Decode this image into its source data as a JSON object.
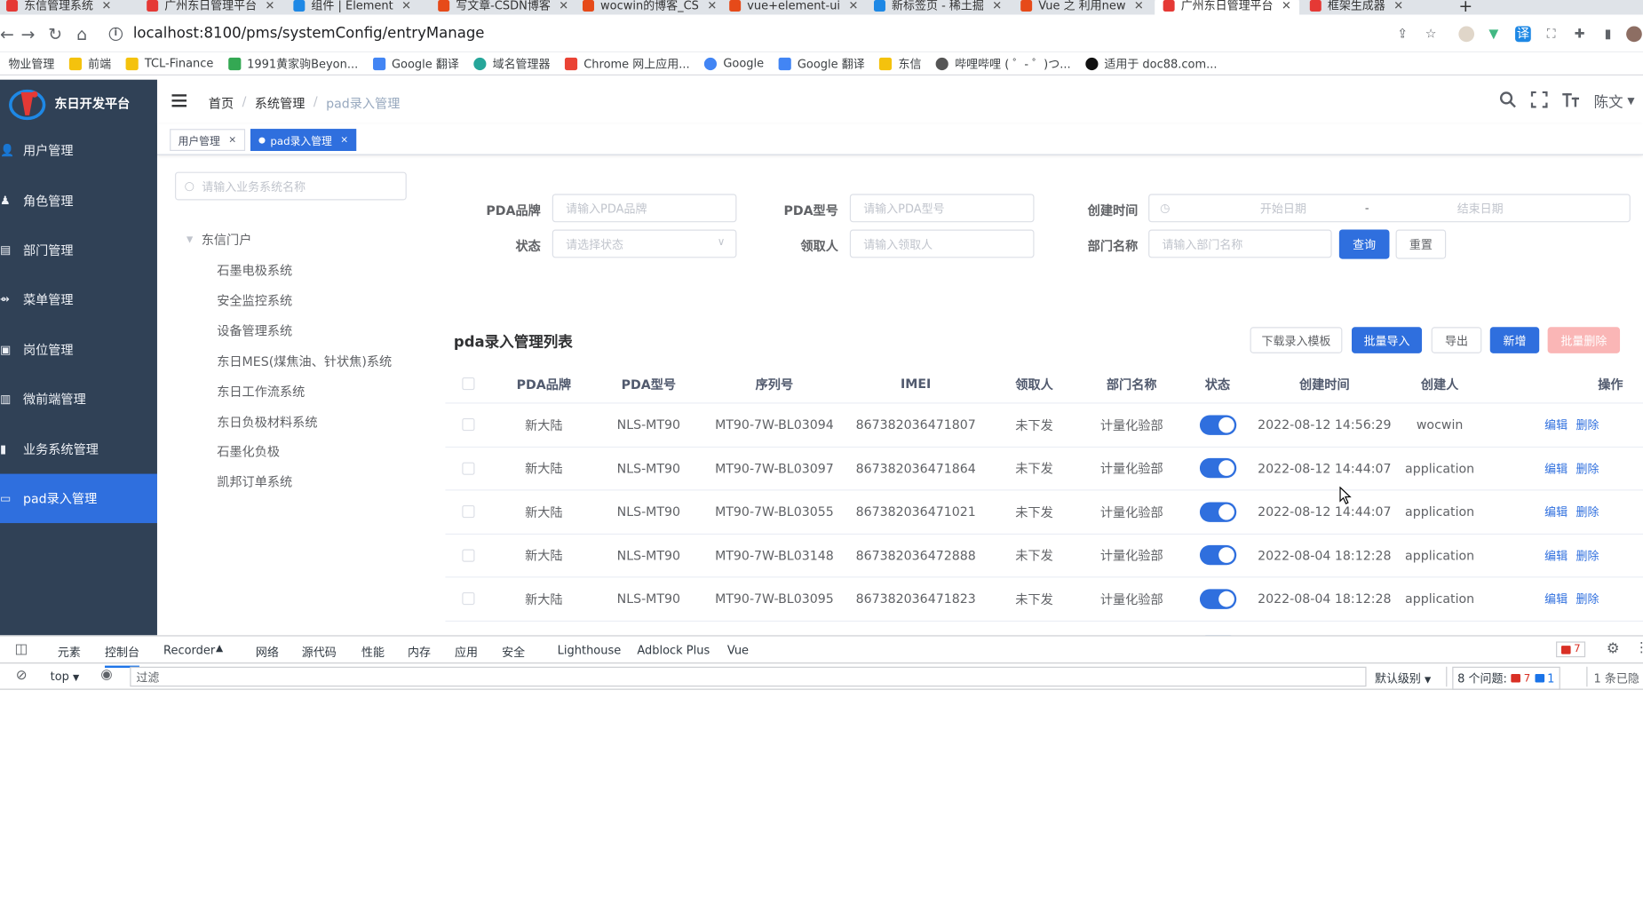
{
  "browser": {
    "tabs": [
      {
        "title": "东信管理系统",
        "color": "#e53935"
      },
      {
        "title": "广州东日管理平台",
        "color": "#e53935"
      },
      {
        "title": "组件 | Element",
        "color": "#1e88e5"
      },
      {
        "title": "写文章-CSDN博客",
        "color": "#e64a19"
      },
      {
        "title": "wocwin的博客_CS",
        "color": "#e64a19"
      },
      {
        "title": "vue+element-ui",
        "color": "#e64a19"
      },
      {
        "title": "新标签页 - 稀土掘",
        "color": "#1e88e5"
      },
      {
        "title": "Vue 之 利用new",
        "color": "#e64a19"
      },
      {
        "title": "广州东日管理平台",
        "color": "#e53935"
      },
      {
        "title": "框架生成器",
        "color": "#e53935"
      }
    ],
    "url": "localhost:8100/pms/systemConfig/entryManage",
    "bookmarks": [
      {
        "label": "物业管理",
        "color": "#f4c20d"
      },
      {
        "label": "前端",
        "color": "#f4c20d"
      },
      {
        "label": "TCL-Finance",
        "color": "#f4c20d"
      },
      {
        "label": "1991黄家驹Beyon...",
        "color": "#34a853"
      },
      {
        "label": "Google 翻译",
        "color": "#4285f4"
      },
      {
        "label": "域名管理器",
        "color": "#26a69a"
      },
      {
        "label": "Chrome 网上应用...",
        "color": "#ea4335"
      },
      {
        "label": "Google",
        "color": "#4285f4"
      },
      {
        "label": "Google 翻译",
        "color": "#4285f4"
      },
      {
        "label": "东信",
        "color": "#f4c20d"
      },
      {
        "label": "哔哩哔哩 ( ゜- ゜)つ...",
        "color": "#555555"
      },
      {
        "label": "适用于 doc88.com...",
        "color": "#111111"
      }
    ]
  },
  "app": {
    "logo_text": "东日开发平台",
    "menu": [
      {
        "label": "用户管理",
        "icon": "user-icon"
      },
      {
        "label": "角色管理",
        "icon": "role-icon"
      },
      {
        "label": "部门管理",
        "icon": "dept-icon"
      },
      {
        "label": "菜单管理",
        "icon": "menu-icon"
      },
      {
        "label": "岗位管理",
        "icon": "post-icon"
      },
      {
        "label": "微前端管理",
        "icon": "micro-icon"
      },
      {
        "label": "业务系统管理",
        "icon": "chart-icon"
      },
      {
        "label": "pad录入管理",
        "icon": "pad-icon",
        "active": true
      }
    ],
    "breadcrumbs": [
      "首页",
      "系统管理",
      "pad录入管理"
    ],
    "user": "陈文",
    "tags": [
      {
        "label": "用户管理",
        "active": false
      },
      {
        "label": "pad录入管理",
        "active": true
      }
    ],
    "tree": {
      "search_placeholder": "请输入业务系统名称",
      "root": "东信门户",
      "nodes": [
        "石墨电极系统",
        "安全监控系统",
        "设备管理系统",
        "东日MES(煤焦油、针状焦)系统",
        "东日工作流系统",
        "东日负极材料系统",
        "石墨化负极",
        "凯邦订单系统"
      ]
    },
    "form": {
      "brand_label": "PDA品牌",
      "brand_placeholder": "请输入PDA品牌",
      "model_label": "PDA型号",
      "model_placeholder": "请输入PDA型号",
      "created_label": "创建时间",
      "start_placeholder": "开始日期",
      "range_sep": "-",
      "end_placeholder": "结束日期",
      "status_label": "状态",
      "status_placeholder": "请选择状态",
      "receiver_label": "领取人",
      "receiver_placeholder": "请输入领取人",
      "dept_label": "部门名称",
      "dept_placeholder": "请输入部门名称",
      "query_btn": "查询",
      "reset_btn": "重置"
    },
    "list": {
      "title": "pda录入管理列表",
      "buttons": {
        "download": "下载录入模板",
        "import": "批量导入",
        "export": "导出",
        "add": "新增",
        "batch_delete": "批量删除"
      },
      "columns": [
        "PDA品牌",
        "PDA型号",
        "序列号",
        "IMEI",
        "领取人",
        "部门名称",
        "状态",
        "创建时间",
        "创建人",
        "操作"
      ],
      "rows": [
        {
          "brand": "新大陆",
          "model": "NLS-MT90",
          "serial": "MT90-7W-BL03094",
          "imei": "867382036471807",
          "receiver": "未下发",
          "dept": "计量化验部",
          "status": true,
          "created": "2022-08-12 14:56:29",
          "creator": "wocwin"
        },
        {
          "brand": "新大陆",
          "model": "NLS-MT90",
          "serial": "MT90-7W-BL03097",
          "imei": "867382036471864",
          "receiver": "未下发",
          "dept": "计量化验部",
          "status": true,
          "created": "2022-08-12 14:44:07",
          "creator": "application"
        },
        {
          "brand": "新大陆",
          "model": "NLS-MT90",
          "serial": "MT90-7W-BL03055",
          "imei": "867382036471021",
          "receiver": "未下发",
          "dept": "计量化验部",
          "status": true,
          "created": "2022-08-12 14:44:07",
          "creator": "application"
        },
        {
          "brand": "新大陆",
          "model": "NLS-MT90",
          "serial": "MT90-7W-BL03148",
          "imei": "867382036472888",
          "receiver": "未下发",
          "dept": "计量化验部",
          "status": true,
          "created": "2022-08-04 18:12:28",
          "creator": "application"
        },
        {
          "brand": "新大陆",
          "model": "NLS-MT90",
          "serial": "MT90-7W-BL03095",
          "imei": "867382036471823",
          "receiver": "未下发",
          "dept": "计量化验部",
          "status": true,
          "created": "2022-08-04 18:12:28",
          "creator": "application"
        }
      ],
      "edit_label": "编辑",
      "delete_label": "删除"
    }
  },
  "devtools": {
    "tabs": [
      "元素",
      "控制台",
      "Recorder",
      "网络",
      "源代码",
      "性能",
      "内存",
      "应用",
      "安全",
      "Lighthouse",
      "Adblock Plus",
      "Vue"
    ],
    "active_tab": "控制台",
    "error_count": "7",
    "context": "top",
    "filter_placeholder": "过滤",
    "level": "默认级别",
    "issues_label": "8 个问题:",
    "issues_errors": "7",
    "issues_info": "1",
    "hidden_label": "1 条已隐"
  }
}
